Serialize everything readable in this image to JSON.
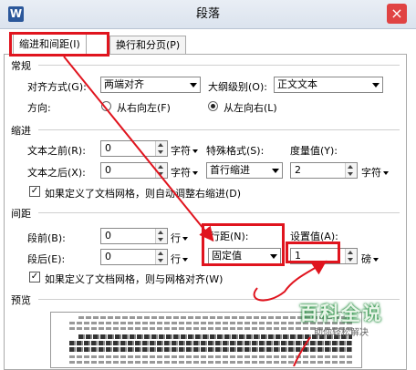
{
  "window": {
    "app_icon": "W",
    "title": "段落",
    "close_glyph": "×"
  },
  "tabs": [
    {
      "label": "缩进和间距(I)",
      "active": true
    },
    {
      "label": "换行和分页(P)",
      "active": false
    }
  ],
  "general": {
    "section_label": "常规",
    "alignment_label": "对齐方式(G):",
    "alignment_value": "两端对齐",
    "outline_label": "大纲级别(O):",
    "outline_value": "正文文本",
    "direction_label": "方向:",
    "rtl_label": "从右向左(F)",
    "ltr_label": "从左向右(L)",
    "ltr_selected": true
  },
  "indent": {
    "section_label": "缩进",
    "before_label": "文本之前(R):",
    "before_value": "0",
    "before_unit": "字符",
    "after_label": "文本之后(X):",
    "after_value": "0",
    "after_unit": "字符",
    "special_label": "特殊格式(S):",
    "special_value": "首行缩进",
    "measure_label": "度量值(Y):",
    "measure_value": "2",
    "measure_unit": "字符",
    "grid_checkbox_label": "如果定义了文档网格，则自动调整右缩进(D)",
    "grid_checked": true
  },
  "spacing": {
    "section_label": "间距",
    "before_label": "段前(B):",
    "before_value": "0",
    "before_unit": "行",
    "after_label": "段后(E):",
    "after_value": "0",
    "after_unit": "行",
    "line_spacing_label": "行距(N):",
    "line_spacing_value": "固定值",
    "set_value_label": "设置值(A):",
    "set_value": "1",
    "set_value_unit": "磅",
    "grid_checkbox_label": "如果定义了文档网格，则与网格对齐(W)",
    "grid_checked": true
  },
  "preview": {
    "section_label": "预览"
  },
  "watermark": {
    "text": "百科全说",
    "subtext": "助你轻松解决"
  },
  "colors": {
    "annotation_red": "#e0141e",
    "brand_blue": "#2b579a"
  }
}
